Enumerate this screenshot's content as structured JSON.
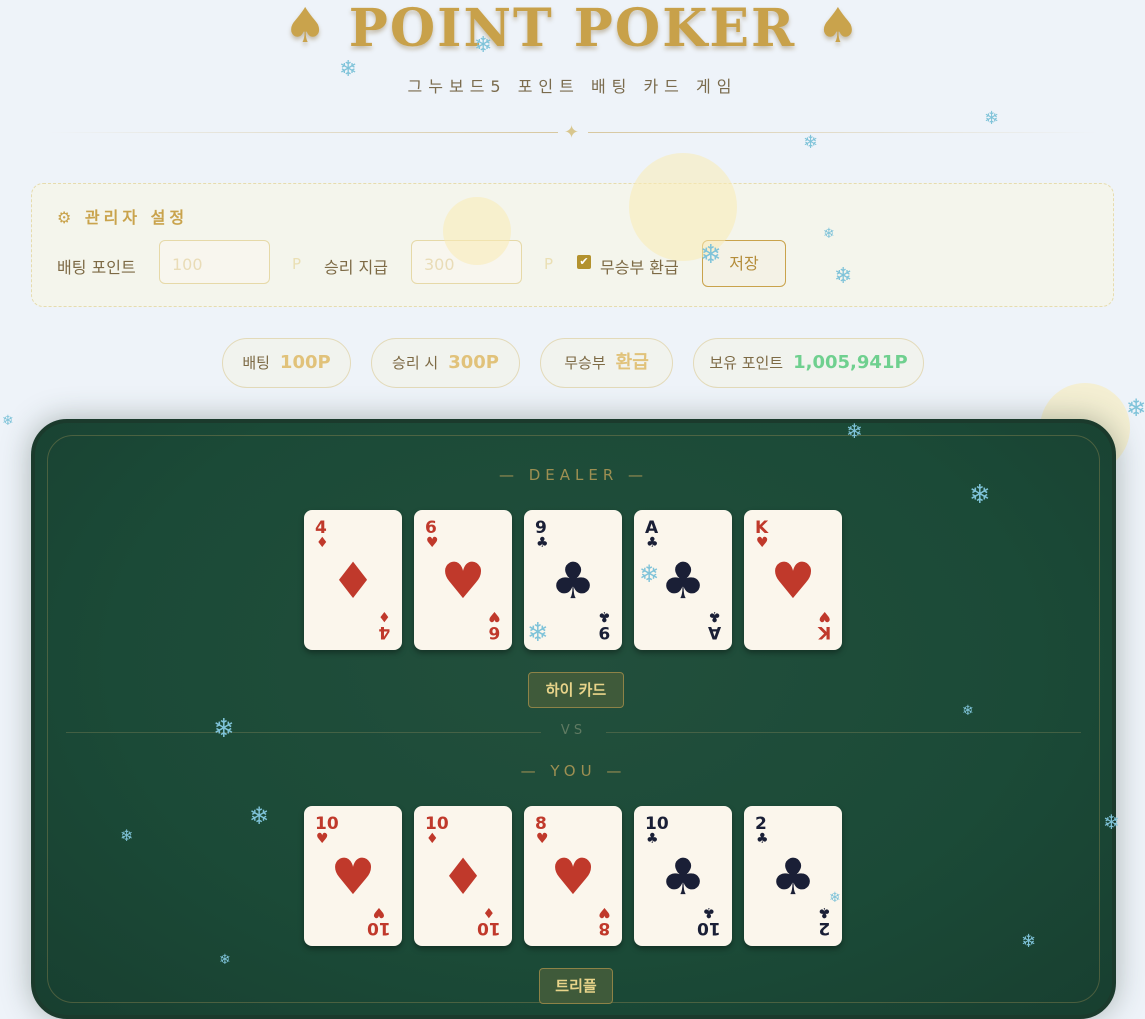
{
  "header": {
    "title": "POINT POKER",
    "subtitle": "그누보드5 포인트 배팅 카드 게임"
  },
  "admin": {
    "title": "⚙ 관리자 설정",
    "bet_label": "배팅 포인트",
    "bet_placeholder": "100",
    "bet_unit": "P",
    "win_label": "승리 지급",
    "win_placeholder": "300",
    "win_unit": "P",
    "refund_label": "무승부 환급",
    "refund_checked": true,
    "save_label": "저장"
  },
  "stats": [
    {
      "label": "배팅",
      "value": "100P"
    },
    {
      "label": "승리 시",
      "value": "300P"
    },
    {
      "label": "무승부",
      "value": "환급"
    },
    {
      "label": "보유 포인트",
      "value": "1,005,941P"
    }
  ],
  "dealer": {
    "label": "— DEALER —",
    "hand_name": "하이 카드",
    "cards": [
      {
        "rank": "4",
        "suit": "♦",
        "color": "red"
      },
      {
        "rank": "6",
        "suit": "♥",
        "color": "red"
      },
      {
        "rank": "9",
        "suit": "♣",
        "color": "black"
      },
      {
        "rank": "A",
        "suit": "♣",
        "color": "black"
      },
      {
        "rank": "K",
        "suit": "♥",
        "color": "red"
      }
    ]
  },
  "vs_label": "VS",
  "player": {
    "label": "— YOU —",
    "hand_name": "트리플",
    "cards": [
      {
        "rank": "10",
        "suit": "♥",
        "color": "red"
      },
      {
        "rank": "10",
        "suit": "♦",
        "color": "red"
      },
      {
        "rank": "8",
        "suit": "♥",
        "color": "red"
      },
      {
        "rank": "10",
        "suit": "♣",
        "color": "black"
      },
      {
        "rank": "2",
        "suit": "♣",
        "color": "black"
      }
    ]
  },
  "icons": {
    "logo_left": "spade-icon",
    "logo_right": "spade-icon",
    "decor": "snowflake-icon"
  },
  "colors": {
    "gold": "#c8a14a",
    "felt": "#1b4a37",
    "points_green": "#6fd08f",
    "card_red": "#c0392b",
    "card_black": "#1a1f36"
  }
}
